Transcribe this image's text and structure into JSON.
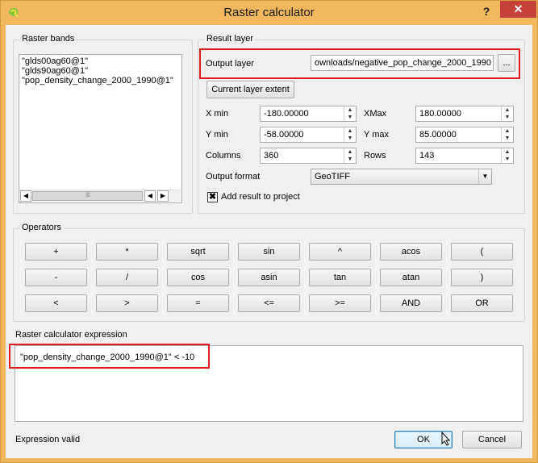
{
  "window": {
    "title": "Raster calculator",
    "help": "?",
    "close": "✕"
  },
  "raster_bands": {
    "title": "Raster bands",
    "items": [
      "\"glds00ag60@1\"",
      "\"glds90ag60@1\"",
      "\"pop_density_change_2000_1990@1\""
    ]
  },
  "result_layer": {
    "title": "Result layer",
    "output_layer_label": "Output layer",
    "output_layer_value": "ownloads/negative_pop_change_2000_1990",
    "browse_label": "...",
    "current_extent_label": "Current layer extent",
    "xmin_label": "X min",
    "xmin_value": "-180.00000",
    "xmax_label": "XMax",
    "xmax_value": "180.00000",
    "ymin_label": "Y min",
    "ymin_value": "-58.00000",
    "ymax_label": "Y max",
    "ymax_value": "85.00000",
    "columns_label": "Columns",
    "columns_value": "360",
    "rows_label": "Rows",
    "rows_value": "143",
    "output_format_label": "Output format",
    "output_format_value": "GeoTIFF",
    "add_result_label": "Add result to project",
    "add_result_checked": "✖"
  },
  "operators": {
    "title": "Operators",
    "row1": [
      "+",
      "*",
      "sqrt",
      "sin",
      "^",
      "acos",
      "("
    ],
    "row2": [
      "-",
      "/",
      "cos",
      "asin",
      "tan",
      "atan",
      ")"
    ],
    "row3": [
      "<",
      ">",
      "=",
      "<=",
      ">=",
      "AND",
      "OR"
    ]
  },
  "expression": {
    "title": "Raster calculator expression",
    "value": "\"pop_density_change_2000_1990@1\" < -10"
  },
  "footer": {
    "status": "Expression valid",
    "ok_label": "OK",
    "cancel_label": "Cancel"
  }
}
